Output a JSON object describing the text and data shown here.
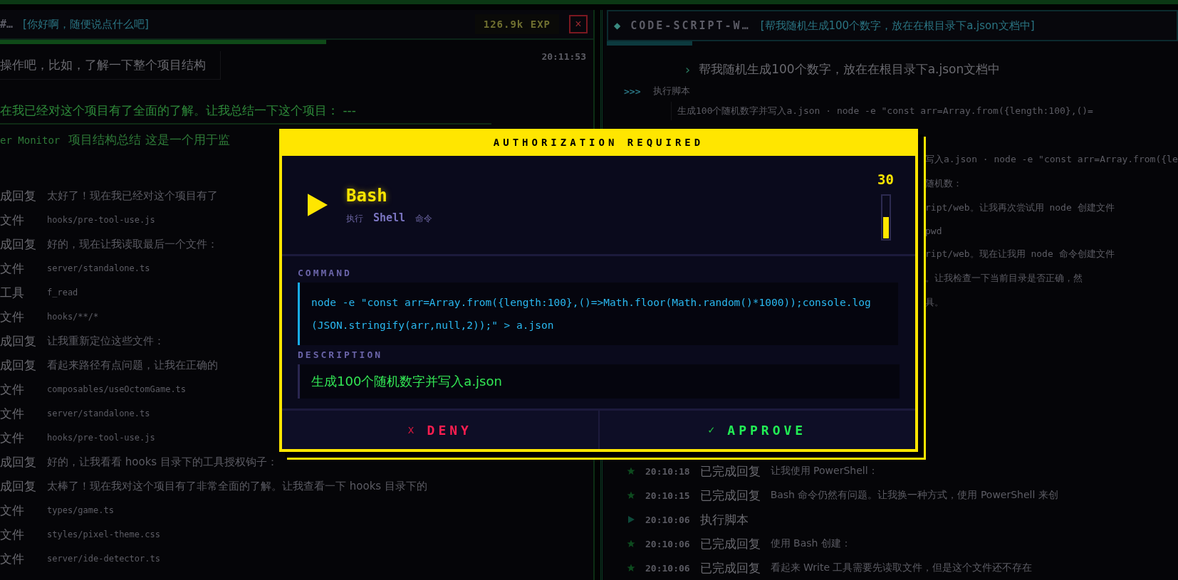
{
  "left_panel": {
    "title": "#…",
    "subtitle": "[你好啊，随便说点什么吧]",
    "exp": "126.9k EXP",
    "close": "×",
    "progress": {
      "level": 0.55
    },
    "user_message": {
      "text": "操作吧，比如，了解一下整个项目结构",
      "time": "20:11:53"
    },
    "summary": "在我已经对这个项目有了全面的了解。让我总结一下这个项目： ---",
    "summary_line": {
      "code": "er Monitor",
      "text": "项目结构总结 这是一个用于监"
    },
    "log": [
      {
        "kind": "reply",
        "label": "成回复",
        "text": "太好了！现在我已经对这个项目有了"
      },
      {
        "kind": "file",
        "label": "文件",
        "text": "hooks/pre-tool-use.js"
      },
      {
        "kind": "reply",
        "label": "成回复",
        "text": "好的，现在让我读取最后一个文件："
      },
      {
        "kind": "file",
        "label": "文件",
        "text": "server/standalone.ts"
      },
      {
        "kind": "file",
        "label": "工具",
        "text": "f_read"
      },
      {
        "kind": "file",
        "label": "文件",
        "text": "hooks/**/*"
      },
      {
        "kind": "reply",
        "label": "成回复",
        "text": "让我重新定位这些文件："
      },
      {
        "kind": "reply",
        "label": "成回复",
        "text": "看起来路径有点问题，让我在正确的"
      },
      {
        "kind": "file",
        "label": "文件",
        "text": "composables/useOctomGame.ts"
      },
      {
        "kind": "file",
        "label": "文件",
        "text": "server/standalone.ts"
      },
      {
        "kind": "file",
        "label": "文件",
        "text": "hooks/pre-tool-use.js"
      },
      {
        "kind": "reply",
        "label": "成回复",
        "text": "好的，让我看看 hooks 目录下的工具授权钩子："
      },
      {
        "kind": "reply",
        "label": "成回复",
        "text": "太棒了！现在我对这个项目有了非常全面的了解。让我查看一下 hooks 目录下的"
      },
      {
        "kind": "file",
        "label": "文件",
        "text": "types/game.ts"
      },
      {
        "kind": "file",
        "label": "文件",
        "text": "styles/pixel-theme.css"
      },
      {
        "kind": "file",
        "label": "文件",
        "text": "server/ide-detector.ts"
      }
    ]
  },
  "right_panel": {
    "marker": "◆",
    "title": "CODE-SCRIPT-W…",
    "subtitle": "[帮我随机生成100个数字，放在在根目录下a.json文档中]",
    "progress": {
      "level": 0.15
    },
    "prompt": {
      "marker": "›",
      "text": "帮我随机生成100个数字，放在在根目录下a.json文档中"
    },
    "step": {
      "marker": ">>>",
      "text": "执行脚本"
    },
    "step_detail": "生成100个随机数字并写入a.json · node -e \"const arr=Array.from({length:100},()=",
    "hidden_lines": [
      {
        "text": "写入a.json · node -e \"const arr=Array.from({le"
      },
      {
        "text": "随机数："
      },
      {
        "text": "ript/web。让我再次尝试用 node 创建文件"
      },
      {
        "text": "pwd"
      },
      {
        "text": "ript/web。现在让我用 node 命令创建文件"
      },
      {
        "text": "。让我检查一下当前目录是否正确，然"
      },
      {
        "text": "具。"
      }
    ],
    "log": [
      {
        "kind": "star",
        "time": "20:10:18",
        "label": "已完成回复",
        "text": "让我使用 PowerShell："
      },
      {
        "kind": "star",
        "time": "20:10:15",
        "label": "已完成回复",
        "text": "Bash 命令仍然有问题。让我换一种方式，使用 PowerShell 来创"
      },
      {
        "kind": "play",
        "time": "20:10:06",
        "label": "执行脚本"
      },
      {
        "kind": "star",
        "time": "20:10:06",
        "label": "已完成回复",
        "text": "使用 Bash 创建："
      },
      {
        "kind": "star",
        "time": "20:10:06",
        "label": "已完成回复",
        "text": "看起来 Write 工具需要先读取文件，但是这个文件还不存在"
      }
    ]
  },
  "dialog": {
    "title": "AUTHORIZATION REQUIRED",
    "tool": "Bash",
    "subtitle": {
      "prefix": "执行",
      "name": "Shell",
      "suffix": "命令"
    },
    "countdown": "30",
    "timer": {
      "level": 0.5
    },
    "command_label": "COMMAND",
    "command": "node -e \"const arr=Array.from({length:100},()=>Math.floor(Math.random()*1000));console.log(JSON.stringify(arr,null,2));\" > a.json",
    "description_label": "DESCRIPTION",
    "description": "生成100个随机数字并写入a.json",
    "buttons": [
      {
        "kind": "deny",
        "icon": "x",
        "label": "DENY"
      },
      {
        "kind": "approve",
        "icon": "✓",
        "label": "APPROVE"
      }
    ]
  }
}
